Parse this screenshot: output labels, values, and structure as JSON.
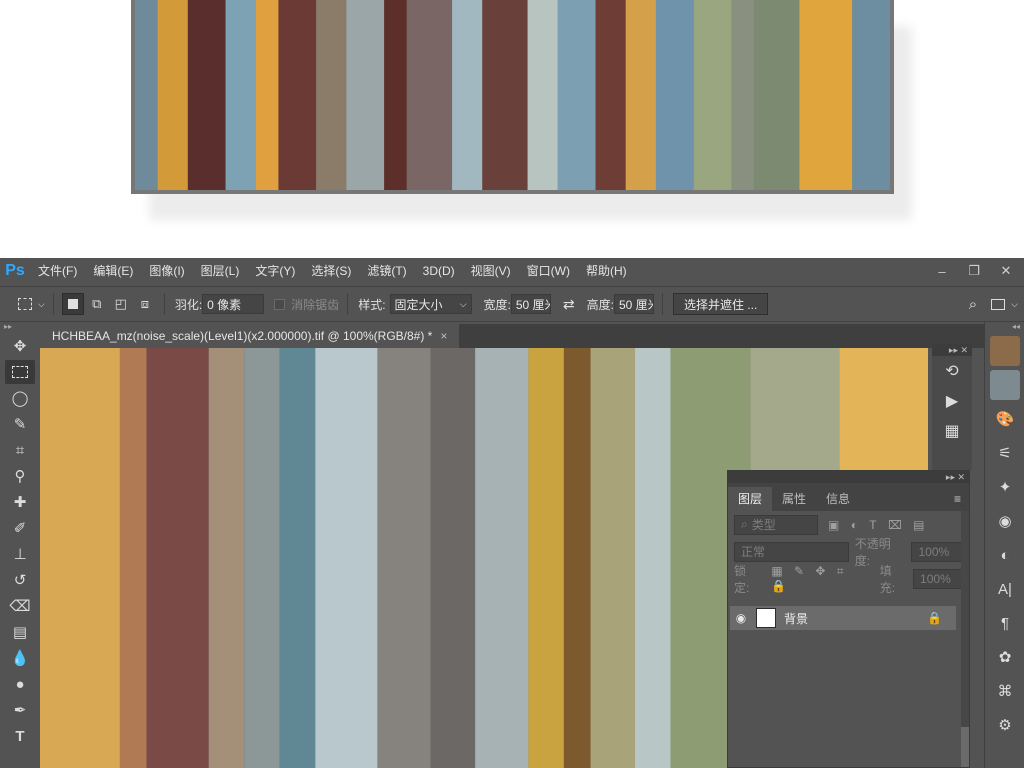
{
  "menu": {
    "logo": "Ps",
    "items": [
      "文件(F)",
      "编辑(E)",
      "图像(I)",
      "图层(L)",
      "文字(Y)",
      "选择(S)",
      "滤镜(T)",
      "3D(D)",
      "视图(V)",
      "窗口(W)",
      "帮助(H)"
    ]
  },
  "window_controls": {
    "minimize": "–",
    "restore": "❐",
    "close": "✕"
  },
  "options": {
    "feather_label": "羽化:",
    "feather_value": "0 像素",
    "antialias_label": "消除锯齿",
    "style_label": "样式:",
    "style_value": "固定大小",
    "width_label": "宽度:",
    "width_value": "50 厘米",
    "height_label": "高度:",
    "height_value": "50 厘米",
    "select_mask_button": "选择并遮住 ..."
  },
  "document_tab": {
    "title": "HCHBEAA_mz(noise_scale)(Level1)(x2.000000).tif @ 100%(RGB/8#) *",
    "close": "×"
  },
  "tools": [
    "move",
    "marquee",
    "lasso",
    "quick-select",
    "crop",
    "eyedropper",
    "healing",
    "brush",
    "stamp",
    "history-brush",
    "eraser",
    "gradient",
    "blur",
    "dodge",
    "pen",
    "type"
  ],
  "layers_panel": {
    "tabs": [
      "图层",
      "属性",
      "信息"
    ],
    "filter_placeholder": "类型",
    "blend_mode": "正常",
    "opacity_label": "不透明度:",
    "opacity_value": "100%",
    "lock_label": "锁定:",
    "fill_label": "填充:",
    "fill_value": "100%",
    "layers": [
      {
        "name": "背景",
        "visible": true,
        "locked": true
      }
    ]
  },
  "colors": {
    "ui_bg": "#535353",
    "dark": "#3f3f3f",
    "ps_blue": "#31a8ff"
  }
}
